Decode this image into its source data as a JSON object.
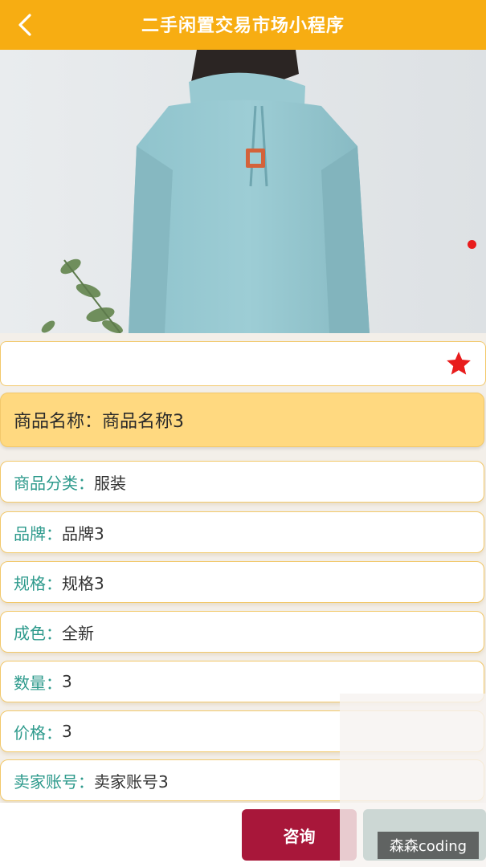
{
  "header": {
    "title": "二手闲置交易市场小程序",
    "back_icon": "chevron-left-icon"
  },
  "hero": {
    "image_alt": "Hooded sweatshirt product photo"
  },
  "favorite": {
    "icon": "star-icon",
    "color": "#e81c1c"
  },
  "product": {
    "name_label": "商品名称：",
    "name_value": "商品名称3"
  },
  "details": [
    {
      "label": "商品分类：",
      "value": "服装"
    },
    {
      "label": "品牌：",
      "value": "品牌3"
    },
    {
      "label": "规格：",
      "value": "规格3"
    },
    {
      "label": "成色：",
      "value": "全新"
    },
    {
      "label": "数量：",
      "value": "3"
    },
    {
      "label": "价格：",
      "value": "3"
    },
    {
      "label": "卖家账号：",
      "value": "卖家账号3"
    }
  ],
  "actions": {
    "consult_label": "咨询"
  },
  "watermark": {
    "text": "森森coding"
  },
  "colors": {
    "header_bg": "#f7ad12",
    "title_card_bg": "#ffd980",
    "label_color": "#2d9a8c",
    "consult_bg": "#a8173a",
    "second_btn_bg": "#0f5b53"
  }
}
